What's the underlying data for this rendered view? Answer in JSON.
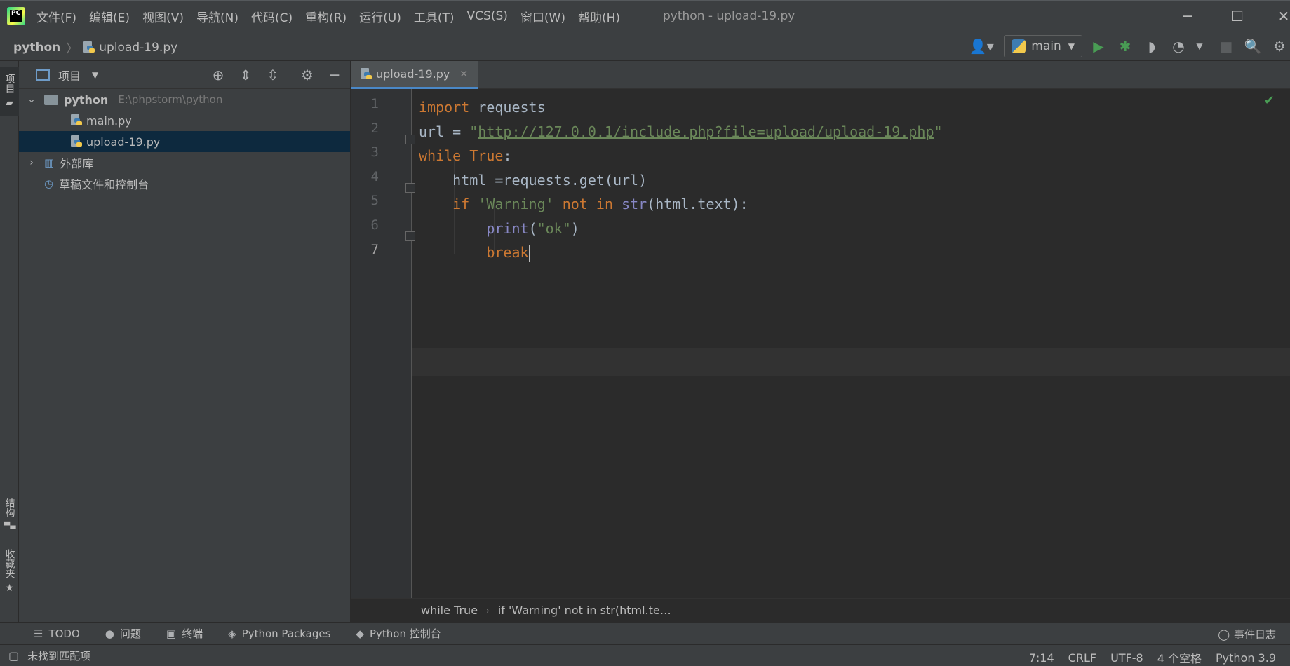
{
  "window": {
    "title": "python - upload-19.py",
    "minimize_glyph": "─",
    "maximize_glyph": "☐",
    "close_glyph": "✕"
  },
  "menu": [
    "文件(F)",
    "编辑(E)",
    "视图(V)",
    "导航(N)",
    "代码(C)",
    "重构(R)",
    "运行(U)",
    "工具(T)",
    "VCS(S)",
    "窗口(W)",
    "帮助(H)"
  ],
  "app_logo_text": "PC",
  "breadcrumb": {
    "project": "python",
    "file": "upload-19.py"
  },
  "run_config": {
    "name": "main"
  },
  "left_stripe": {
    "project": "项目",
    "structure": "结构",
    "favorites": "收藏夹"
  },
  "project_panel": {
    "title": "项目",
    "root": {
      "name": "python",
      "path": "E:\\phpstorm\\python"
    },
    "files": [
      "main.py",
      "upload-19.py"
    ],
    "external_libraries": "外部库",
    "scratches": "草稿文件和控制台",
    "selected_file": "upload-19.py"
  },
  "editor": {
    "tab": "upload-19.py",
    "caret_position": "7:14",
    "lines": [
      {
        "n": "1"
      },
      {
        "n": "2"
      },
      {
        "n": "3"
      },
      {
        "n": "4"
      },
      {
        "n": "5"
      },
      {
        "n": "6"
      },
      {
        "n": "7"
      }
    ],
    "code": {
      "l1_kw": "import",
      "l1_rest": " requests",
      "l2_a": "url = ",
      "l2_q1": "\"",
      "l2_url": "http://127.0.0.1/include.php?file=upload/upload-19.php",
      "l2_q2": "\"",
      "l3_kw": "while",
      "l3_true": " True",
      "l3_colon": ":",
      "l4": "    html =requests.get(url)",
      "l5_indent": "    ",
      "l5_if": "if",
      "l5_str": " 'Warning'",
      "l5_not": " not",
      "l5_in": " in",
      "l5_sp": " ",
      "l5_str_fn": "str",
      "l5_rest": "(html.text):",
      "l6_indent": "        ",
      "l6_print": "print",
      "l6_p1": "(",
      "l6_str": "\"ok\"",
      "l6_p2": ")",
      "l7_indent": "        ",
      "l7_kw": "break"
    }
  },
  "editor_breadcrumbs": [
    "while True",
    "if 'Warning' not in str(html.te…"
  ],
  "tool_windows": [
    "TODO",
    "问题",
    "终端",
    "Python Packages",
    "Python 控制台"
  ],
  "event_log": "事件日志",
  "status": {
    "message": "未找到匹配项",
    "position": "7:14",
    "line_separator": "CRLF",
    "encoding": "UTF-8",
    "indent": "4 个空格",
    "interpreter": "Python 3.9"
  },
  "colors": {
    "background": "#2b2b2b",
    "panel": "#3c3f41",
    "keyword": "#cc7832",
    "string": "#6a8759",
    "builtin": "#8888c6",
    "selection": "#0d293e",
    "run_green": "#499c54"
  }
}
